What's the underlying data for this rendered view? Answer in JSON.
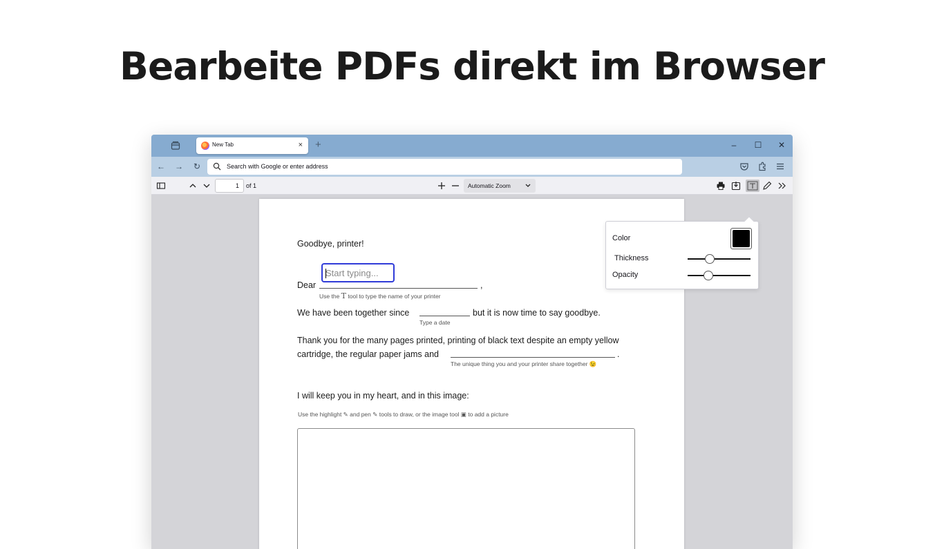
{
  "headline": "Bearbeite PDFs direkt im Browser",
  "browser": {
    "tab": {
      "title": "New Tab",
      "close": "×"
    },
    "new_tab": "+",
    "window_controls": {
      "minimize": "–",
      "maximize": "☐",
      "close": "✕"
    },
    "nav": {
      "back": "←",
      "forward": "→",
      "reload": "↻"
    },
    "urlbar": {
      "placeholder": "Search with Google or enter address"
    }
  },
  "pdf_toolbar": {
    "page_number": "1",
    "of_pages": "of 1",
    "zoom": "Automatic Zoom"
  },
  "document": {
    "greeting": "Goodbye, printer!",
    "dear": "Dear",
    "comma": ",",
    "hint_name_pre": "Use the",
    "hint_name_tool": "T",
    "hint_name_post": "tool to type the name of your printer",
    "together_pre": "We have been together since",
    "together_post": "but it is now time to say goodbye.",
    "hint_date": "Type a date",
    "thanks_line1": "Thank you for the many pages printed, printing of black text despite an empty yellow",
    "thanks_line2": "cartridge, the regular paper jams and",
    "period": ".",
    "hint_unique": "The unique thing  you and your printer share together 😉",
    "heart": "I will keep you in my heart, and in this image:",
    "hint_draw": "Use the highlight ✎ and pen ✎ tools to draw, or the image tool ▣ to add a picture"
  },
  "text_editor": {
    "placeholder": "Start typing..."
  },
  "text_popup": {
    "color_label": "Color",
    "color_value": "#000000",
    "thickness_label": "Thickness",
    "thickness_value": 0.35,
    "opacity_label": "Opacity",
    "opacity_value": 0.33
  },
  "icons": {
    "tab_list": "tab-list-icon",
    "pocket": "pocket-icon",
    "extensions": "extensions-icon",
    "menu": "hamburger-menu-icon",
    "sidebar": "sidebar-toggle-icon",
    "print": "print-icon",
    "save": "save-icon",
    "text_tool": "text-tool-icon",
    "draw_tool": "pen-icon",
    "more": "more-tools-icon"
  }
}
